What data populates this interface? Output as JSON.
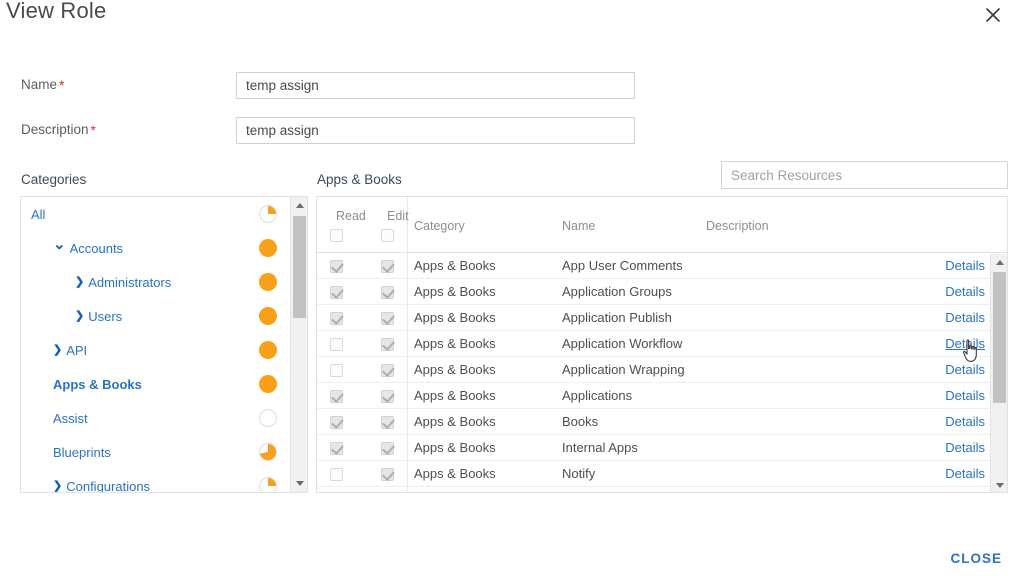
{
  "dialog": {
    "title": "View Role",
    "close_icon": "close-icon",
    "close_button_label": "CLOSE"
  },
  "form": {
    "fields": [
      {
        "label": "Name",
        "required": true,
        "value": "temp assign",
        "placeholder": ""
      },
      {
        "label": "Description",
        "required": true,
        "value": "temp assign",
        "placeholder": ""
      }
    ],
    "required_marker": "*"
  },
  "captions": {
    "categories": "Categories",
    "resources": "Apps & Books"
  },
  "search": {
    "value": "",
    "placeholder": "Search Resources"
  },
  "categories": {
    "items": [
      {
        "label": "All",
        "indent": 0,
        "chevron": "none",
        "bold": false,
        "fill": 25
      },
      {
        "label": "Accounts",
        "indent": 1,
        "chevron": "down",
        "bold": false,
        "fill": 100
      },
      {
        "label": "Administrators",
        "indent": 2,
        "chevron": "right",
        "bold": false,
        "fill": 100
      },
      {
        "label": "Users",
        "indent": 2,
        "chevron": "right",
        "bold": false,
        "fill": 100
      },
      {
        "label": "API",
        "indent": 1,
        "chevron": "right",
        "bold": false,
        "fill": 100
      },
      {
        "label": "Apps & Books",
        "indent": 1,
        "chevron": "none",
        "bold": true,
        "fill": 100
      },
      {
        "label": "Assist",
        "indent": 1,
        "chevron": "none",
        "bold": false,
        "fill": 0
      },
      {
        "label": "Blueprints",
        "indent": 1,
        "chevron": "none",
        "bold": false,
        "fill": 72
      },
      {
        "label": "Configurations",
        "indent": 1,
        "chevron": "right",
        "bold": false,
        "fill": 25
      }
    ],
    "scrollbar": {
      "up_icon": "scroll-up-arrow-icon",
      "down_icon": "scroll-down-arrow-icon"
    }
  },
  "table": {
    "columns": [
      "Read",
      "Edit",
      "Category",
      "Name",
      "Description"
    ],
    "header_checkboxes": [
      false,
      false
    ],
    "details_label": "Details",
    "rows": [
      {
        "read": true,
        "edit": true,
        "category": "Apps & Books",
        "name": "App User Comments",
        "description": "",
        "details": "Details",
        "hover": false
      },
      {
        "read": true,
        "edit": true,
        "category": "Apps & Books",
        "name": "Application Groups",
        "description": "",
        "details": "Details",
        "hover": false
      },
      {
        "read": true,
        "edit": true,
        "category": "Apps & Books",
        "name": "Application Publish",
        "description": "",
        "details": "Details",
        "hover": false
      },
      {
        "read": false,
        "edit": true,
        "category": "Apps & Books",
        "name": "Application Workflow",
        "description": "",
        "details": "Details",
        "hover": true
      },
      {
        "read": false,
        "edit": true,
        "category": "Apps & Books",
        "name": "Application Wrapping",
        "description": "",
        "details": "Details",
        "hover": false
      },
      {
        "read": true,
        "edit": true,
        "category": "Apps & Books",
        "name": "Applications",
        "description": "",
        "details": "Details",
        "hover": false
      },
      {
        "read": true,
        "edit": true,
        "category": "Apps & Books",
        "name": "Books",
        "description": "",
        "details": "Details",
        "hover": false
      },
      {
        "read": true,
        "edit": true,
        "category": "Apps & Books",
        "name": "Internal Apps",
        "description": "",
        "details": "Details",
        "hover": false
      },
      {
        "read": false,
        "edit": true,
        "category": "Apps & Books",
        "name": "Notify",
        "description": "",
        "details": "Details",
        "hover": false
      },
      {
        "read": false,
        "edit": true,
        "category": "",
        "name": "",
        "description": "",
        "details": "",
        "hover": false
      }
    ],
    "scrollbar": {
      "up_icon": "scroll-up-arrow-icon",
      "down_icon": "scroll-down-arrow-icon"
    }
  },
  "colors": {
    "accent_orange": "#f9a01b",
    "link_blue": "#2a72c4",
    "required_red": "#d0342c",
    "border_gray": "#dfe3e6"
  }
}
